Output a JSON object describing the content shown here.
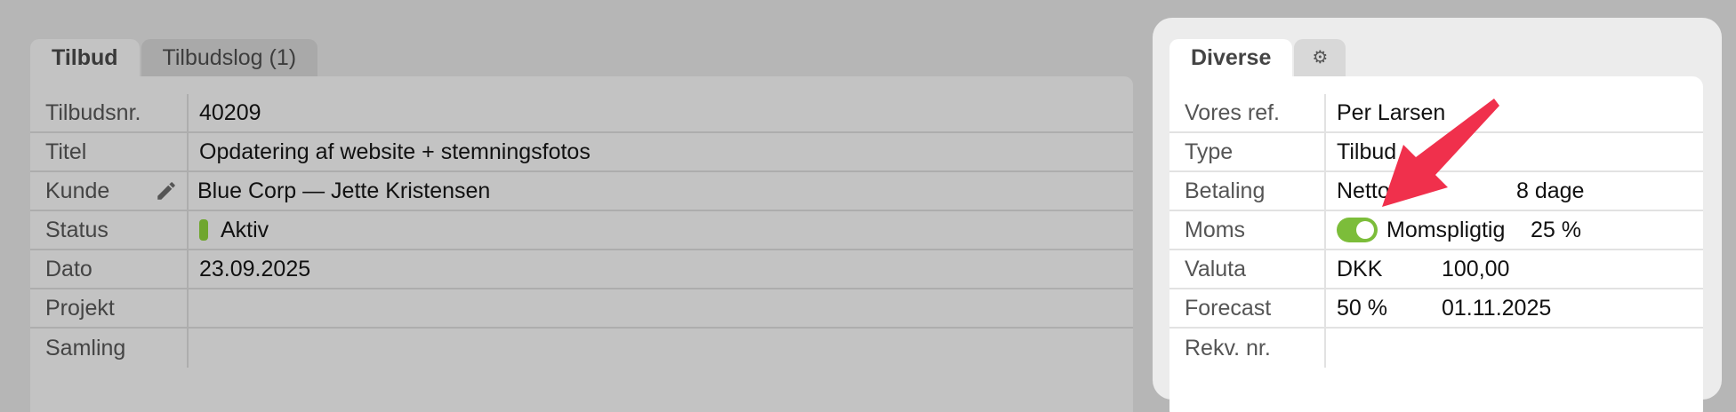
{
  "left_panel": {
    "tabs": [
      {
        "label": "Tilbud"
      },
      {
        "label": "Tilbudslog (1)"
      }
    ],
    "rows": [
      {
        "label": "Tilbudsnr.",
        "value": "40209"
      },
      {
        "label": "Titel",
        "value": "Opdatering af website + stemningsfotos"
      },
      {
        "label": "Kunde",
        "value": "Blue Corp — Jette Kristensen",
        "icon": "pencil-icon"
      },
      {
        "label": "Status",
        "value": "Aktiv",
        "status_color": "#6fa62e"
      },
      {
        "label": "Dato",
        "value": "23.09.2025"
      },
      {
        "label": "Projekt",
        "value": ""
      },
      {
        "label": "Samling",
        "value": ""
      }
    ]
  },
  "right_panel": {
    "tabs": [
      {
        "label": "Diverse"
      },
      {
        "label": "⚙",
        "icon": "gear-icon"
      }
    ],
    "rows": [
      {
        "label": "Vores ref.",
        "value": "Per Larsen"
      },
      {
        "label": "Type",
        "value": "Tilbud"
      },
      {
        "label": "Betaling",
        "value": "Netto",
        "value2": "8 dage"
      },
      {
        "label": "Moms",
        "toggle": true,
        "value": "Momspligtig",
        "value2": "25 %"
      },
      {
        "label": "Valuta",
        "value": "DKK",
        "value2": "100,00"
      },
      {
        "label": "Forecast",
        "value": "50 %",
        "value2": "01.11.2025"
      },
      {
        "label": "Rekv. nr.",
        "value": ""
      }
    ]
  },
  "colors": {
    "background": "#b6b6b6",
    "status_active": "#6fa62e",
    "toggle_on": "#7cbd3a",
    "annotation_arrow": "#f0304c"
  }
}
